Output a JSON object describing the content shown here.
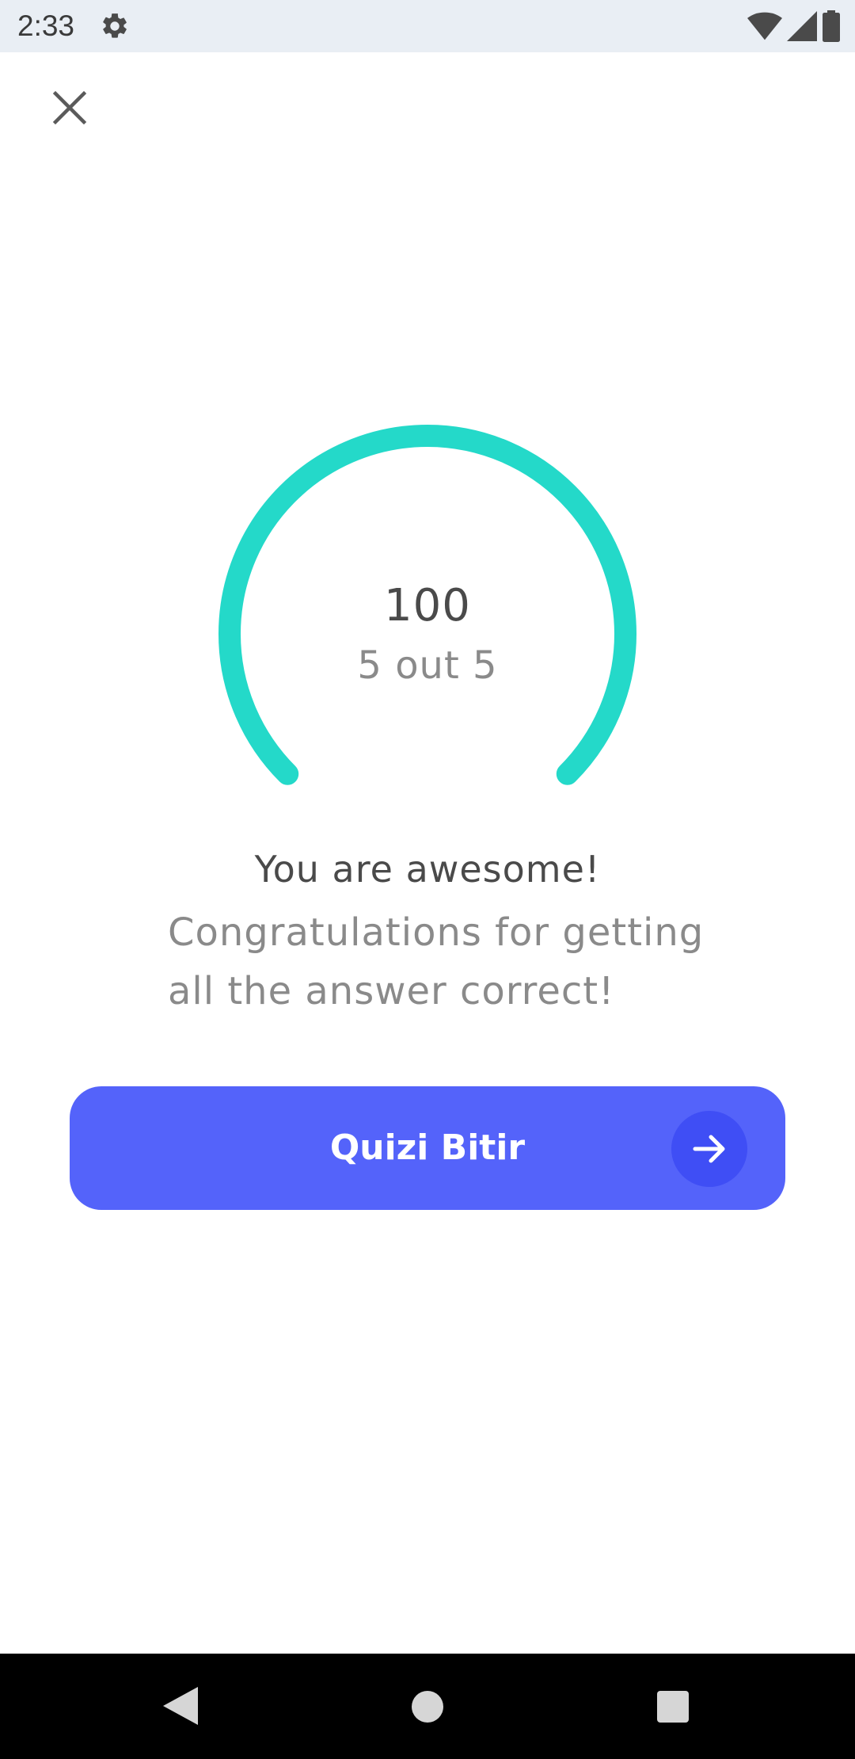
{
  "status_bar": {
    "time": "2:33",
    "icons": [
      "gear-icon",
      "wifi-icon",
      "signal-icon",
      "battery-icon"
    ]
  },
  "header": {
    "close_icon": "close-icon"
  },
  "result": {
    "score": "100",
    "detail": "5 out 5",
    "progress": 1.0,
    "gauge_color": "#24d9c9"
  },
  "feedback": {
    "headline": "You are awesome!",
    "message": "Congratulations for getting all the answer correct!"
  },
  "finish_button": {
    "label": "Quizi Bitir",
    "icon": "arrow-right-icon",
    "color": "#5463fa"
  },
  "nav_bar": {
    "buttons": [
      "back-icon",
      "home-icon",
      "recents-icon"
    ]
  }
}
